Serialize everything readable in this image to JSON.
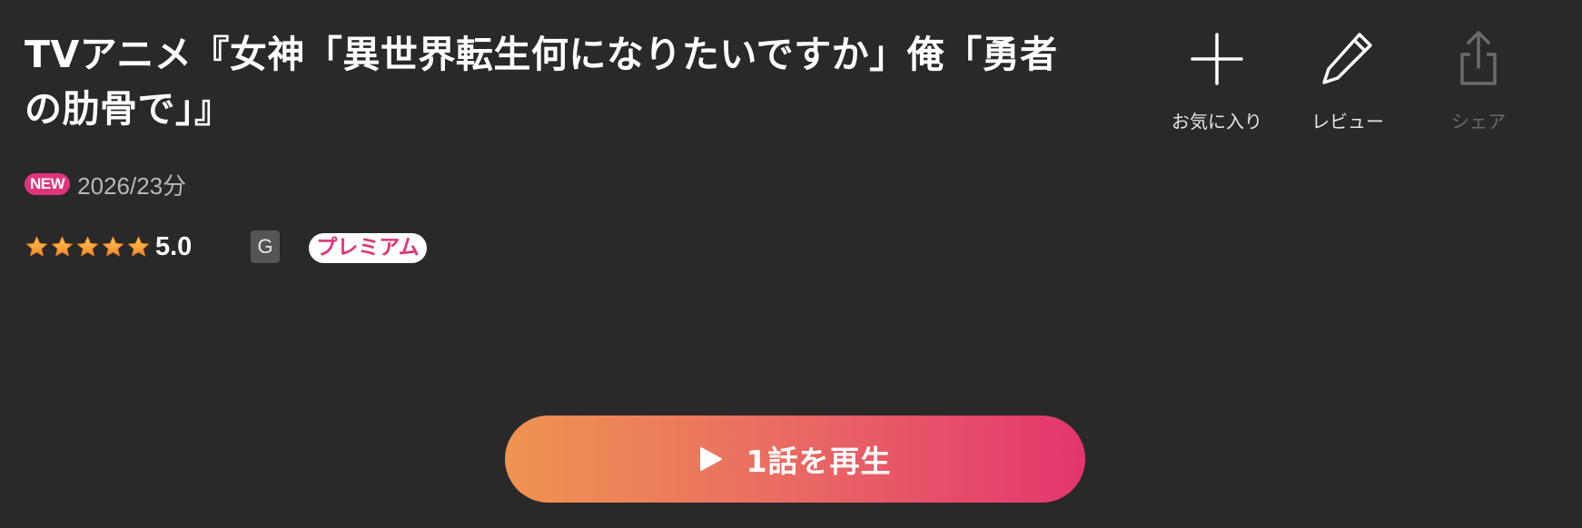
{
  "title": "TVアニメ『女神「異世界転生何になりたいですか」俺「勇者の肋骨で」』",
  "badge_new": "NEW",
  "meta": "2026/23分",
  "rating": {
    "value": "5.0",
    "stars_filled": 5,
    "stars_total": 5
  },
  "age_rating": "G",
  "premium_label": "プレミアム",
  "actions": {
    "favorite": {
      "label": "お気に入り",
      "icon": "plus-icon"
    },
    "review": {
      "label": "レビュー",
      "icon": "pencil-icon"
    },
    "share": {
      "label": "シェア",
      "icon": "share-icon",
      "disabled": true
    }
  },
  "play_button": {
    "label": "1話を再生",
    "icon": "play-icon"
  },
  "colors": {
    "background": "#292929",
    "accent_pink": "#e0357a",
    "accent_orange": "#ef9450",
    "star": "#f6a623"
  }
}
